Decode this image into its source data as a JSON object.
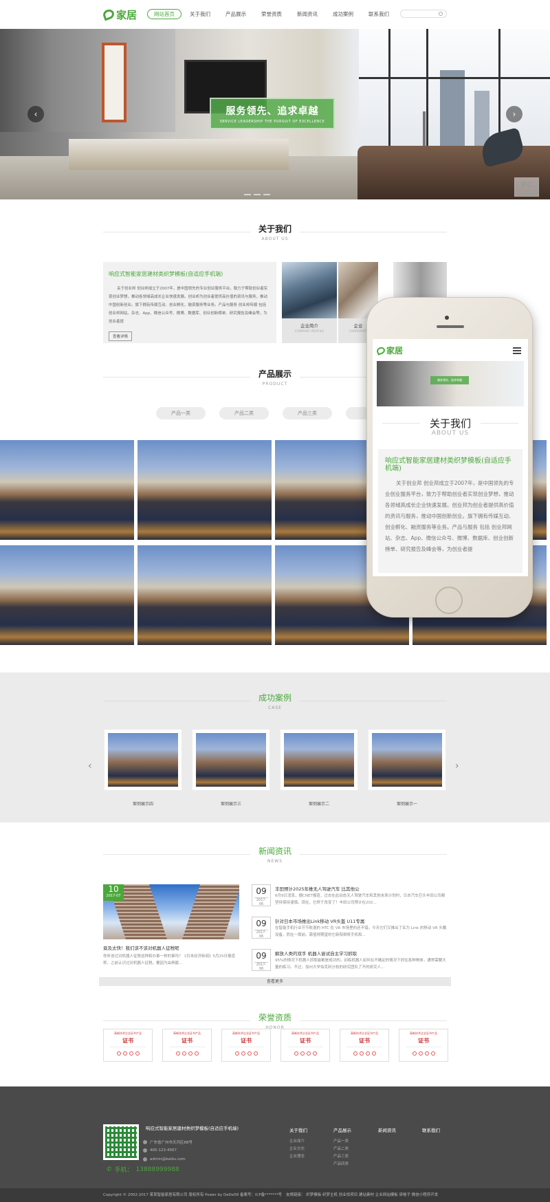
{
  "header": {
    "logo_text": "家居",
    "nav": [
      "网站首页",
      "关于我们",
      "产品展示",
      "荣誉资质",
      "新闻资讯",
      "成功案例",
      "联系我们"
    ],
    "active_index": 0
  },
  "banner": {
    "slogan_zh": "服务领先、追求卓越",
    "slogan_en": "SERVICE LEADERSHIP THE PURSUIT OF EXCELLENCE",
    "badge": "PC"
  },
  "about": {
    "heading_zh": "关于我们",
    "heading_en": "ABOUT US",
    "box_title": "响应式智能家居建材类织梦模板(自适应手机端)",
    "box_text": "关于创业邦 创业邦成立于2007年，是中国领先的专业创业服务平台，致力于帮助创业者实现创业梦想，推动各领域高成长企业快速发展。创业邦为创业者提供高价值的资讯与服务，推动中国创新创业。旗下拥有传媒互动、创业孵化、融资服务等业务。产品与服务 创业邦传媒 包括 创业邦网站、杂志、App、微信公众号、微博、数据库、创业创新榜单、研究报告及峰会等，为创业者提",
    "more_button": "查看详情",
    "tiles": [
      {
        "title": "企业简介",
        "subtitle": "COMPANY PROFILE"
      },
      {
        "title": "企业",
        "subtitle": "CORPORATE"
      }
    ]
  },
  "products": {
    "heading_zh": "产品展示",
    "heading_en": "PRODUCT",
    "tabs": [
      "产品一类",
      "产品二类",
      "产品三类",
      "产"
    ]
  },
  "phone": {
    "logo_text": "家居",
    "title": "关于我们",
    "subtitle": "ABOUT US",
    "box_title": "响应式智能家居建材类织梦模板(自适应手机端)",
    "box_text": "关于创业邦 创业邦成立于2007年，是中国领先的专业创业服务平台，致力于帮助创业者实现创业梦想，推动各领域高成长企业快速发展。创业邦为创业者提供高价值的资讯与服务，推动中国创新创业。旗下拥有传媒互动、创业孵化、融资服务等业务。产品与服务 包括 创业邦网站、杂志、App、微信公众号、微博、数据库、创业创新榜单、研究报告及峰会等，为创业者提"
  },
  "cases": {
    "heading_zh": "成功案例",
    "heading_en": "CASE",
    "items": [
      "案例展示四",
      "案例展示三",
      "案例展示二",
      "案例展示一"
    ]
  },
  "news": {
    "heading_zh": "新闻资讯",
    "heading_en": "NEWS",
    "featured": {
      "day": "10",
      "month": "2017-07",
      "title": "竟及太快！我们该不该对机器人征税呢",
      "desc": "你听说过对机器人征税这种和办事一样的事吗？《日本经济新闻》5月25日报道称，之前认识过对机器人征税。要因为由再献..."
    },
    "items": [
      {
        "day": "09",
        "month": "2017-06",
        "title": "丰田预计2025年推无人驾驶汽车 比其他公",
        "desc": "6月9日消息，据CNET报道，过去在此动态无人驾驶汽车和其他未来计划时，日本汽车巨头丰田公司都坚持保持谨慎。现在，它终于改变了！丰田公司预计在202..."
      },
      {
        "day": "09",
        "month": "2017-06",
        "title": "针对日本市场推出Link移动 VR头盔 U11专属",
        "desc": "在智能手机行业节节败退的 HTC 在 VR 市场里的还不错。今天它们又推出了名为 Link 的移动 VR 头戴设备，而在一周前。需值得期望的它新院倒将手机和..."
      },
      {
        "day": "09",
        "month": "2017-06",
        "title": "解放人类的双手 机器人尝试自主学习抓取",
        "desc": "95%的情况下机器人抓取能都是成功的。训练机器人如何在不确定的情况下抓住各种物体，通常需要大量的练习。不过，加州大学伯克利分校的研究团队了不的研究人..."
      }
    ],
    "more_button": "查看更多"
  },
  "honor": {
    "heading_zh": "荣誉资质",
    "heading_en": "HONOR",
    "cert_heading": "高新技术企业证书产品",
    "cert_label": "证书",
    "cert_count": 6
  },
  "footer": {
    "company": "响应式智能家居建材类织梦模板(自适应手机端)",
    "address": "广东省广州市天河区88号",
    "tel": "400-123-4567",
    "email": "admin@baidu.com",
    "phone_label": "手机：",
    "phone": "13888999988",
    "columns": [
      {
        "title": "关于我们",
        "items": [
          "企业简介",
          "企业文化",
          "企业理念"
        ]
      },
      {
        "title": "产品展示",
        "items": [
          "产品一类",
          "产品二类",
          "产品三类",
          "产品四类"
        ]
      },
      {
        "title": "新闻资讯",
        "items": []
      },
      {
        "title": "联系我们",
        "items": []
      }
    ],
    "copyright": "Copyright © 2002-2017 某某智能家居有限公司 版权所有 Power by DeDe58 备案号：ICP备*******号",
    "links": "友情链接：  织梦模板  织梦主机  创业找项目  建站素材  企业网站模板  穿梭子  微信小程序开发"
  },
  "colors": {
    "brand_green": "#4aa83a",
    "footer_bg": "#4a4a4a",
    "cases_bg": "#ebebeb"
  }
}
